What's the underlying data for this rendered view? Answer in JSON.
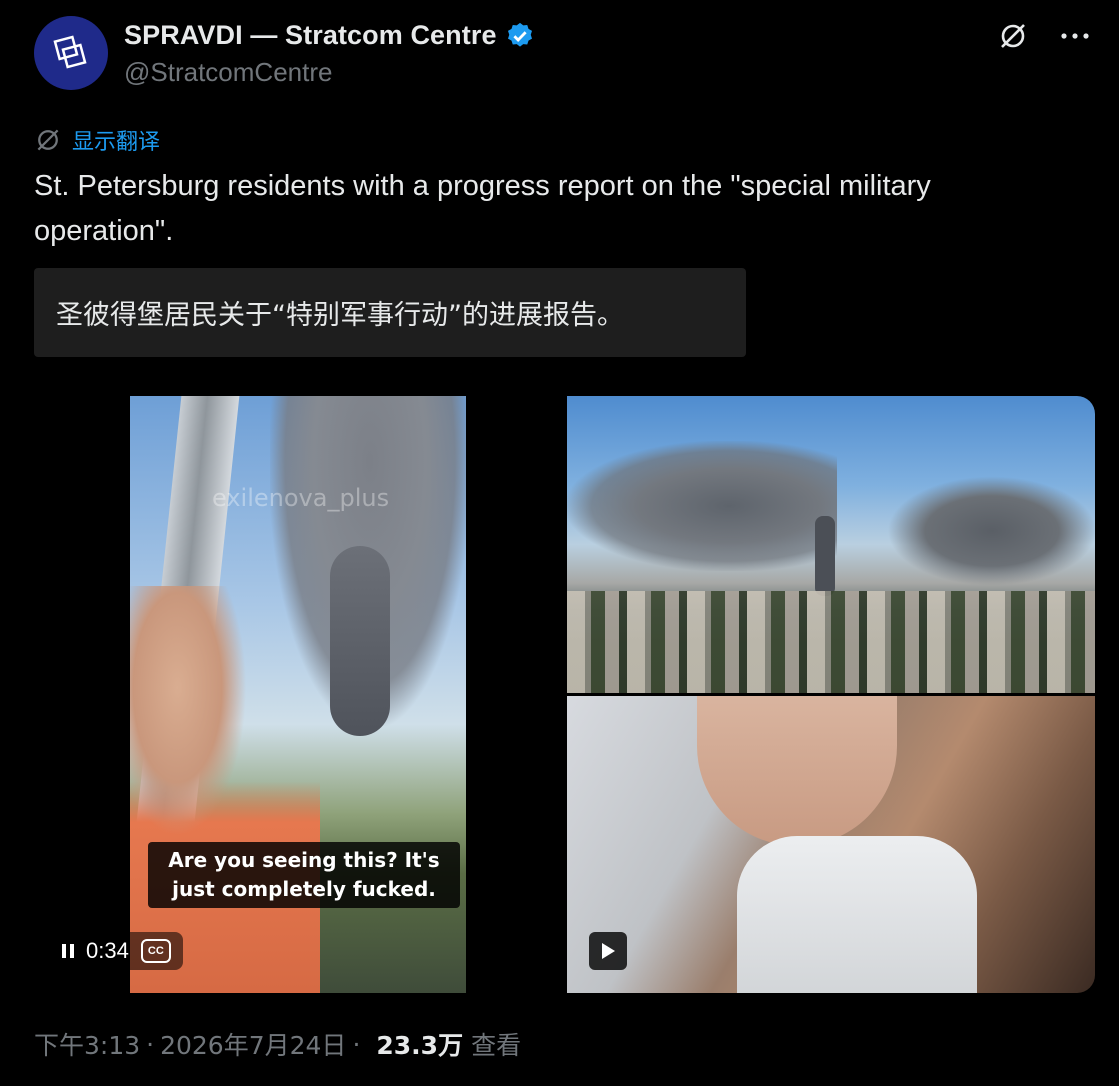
{
  "author": {
    "name": "SPRAVDI — Stratcom Centre",
    "handle": "@StratcomCentre",
    "verified": true,
    "avatar_color": "#1f2a8a"
  },
  "header_icons": [
    "grok-icon",
    "more-icon"
  ],
  "translate": {
    "label": "显示翻译"
  },
  "tweet": {
    "text": "St. Petersburg residents with a progress report on the \"special military operation\".",
    "translation": "圣彼得堡居民关于“特别军事行动”的进展报告。"
  },
  "media": {
    "video": {
      "watermark": "exilenova_plus",
      "caption": "Are you seeing this? It's just completely fucked.",
      "time": "0:34",
      "cc_label": "CC"
    }
  },
  "footer": {
    "time": "下午3:13",
    "date": "2026年7月24日",
    "views": "23.3万",
    "views_label": "查看"
  },
  "colors": {
    "background": "#000000",
    "text": "#e7e9ea",
    "muted": "#71767b",
    "accent": "#1d9bf0"
  }
}
